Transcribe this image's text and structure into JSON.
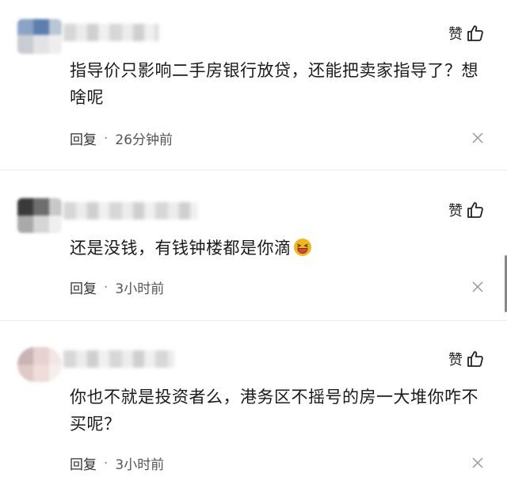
{
  "comments": [
    {
      "like_label": "赞",
      "text": "指导价只影响二手房银行放贷，还能把卖家指导了？想啥呢",
      "reply_label": "回复",
      "separator": "·",
      "time": "26分钟前"
    },
    {
      "like_label": "赞",
      "text": "还是没钱，有钱钟楼都是你滴",
      "reply_label": "回复",
      "separator": "·",
      "time": "3小时前"
    },
    {
      "like_label": "赞",
      "text": "你也不就是投资者么，港务区不摇号的房一大堆你咋不买呢？",
      "reply_label": "回复",
      "separator": "·",
      "time": "3小时前"
    }
  ],
  "icons": {
    "like": "thumbs-up-icon",
    "close": "close-icon",
    "emoji": "laughing-emoji-icon"
  },
  "colors": {
    "text": "#1a1a1a",
    "meta": "#555555",
    "emoji_face": "#f2b51e",
    "emoji_mouth": "#e0453b"
  }
}
